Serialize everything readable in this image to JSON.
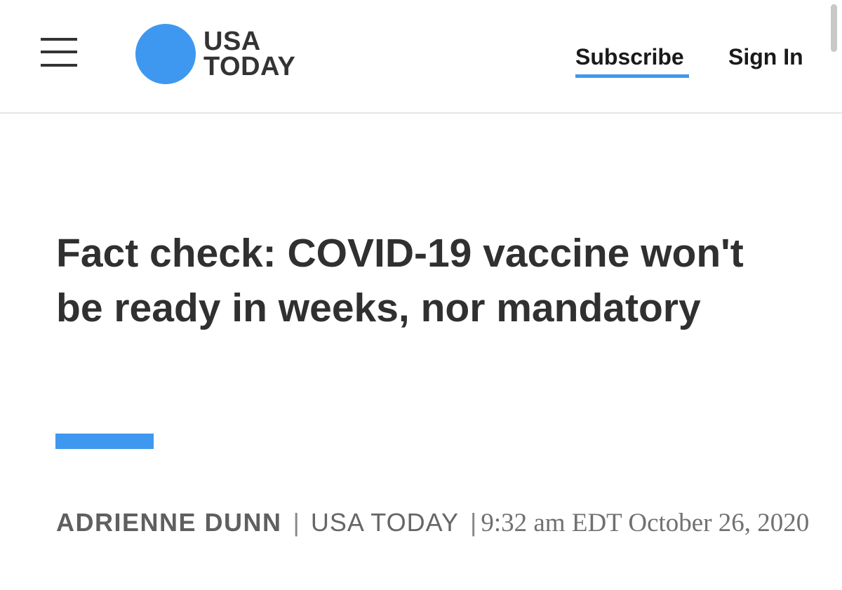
{
  "header": {
    "logo": {
      "line1": "USA",
      "line2": "TODAY"
    },
    "nav": {
      "subscribe_label": "Subscribe",
      "signin_label": "Sign In"
    }
  },
  "article": {
    "headline": "Fact check: COVID-19 vaccine won't be ready in weeks, nor mandatory",
    "byline": {
      "author": "ADRIENNE DUNN",
      "separator": "|",
      "publication": "USA TODAY",
      "separator2": "|",
      "timestamp": "9:32 am EDT October 26, 2020"
    }
  },
  "colors": {
    "brand_blue": "#3f98f0",
    "text_dark": "#303030",
    "byline_gray": "#666666"
  },
  "icons": {
    "menu": "hamburger-menu-icon",
    "logo": "usa-today-dot-logo"
  }
}
